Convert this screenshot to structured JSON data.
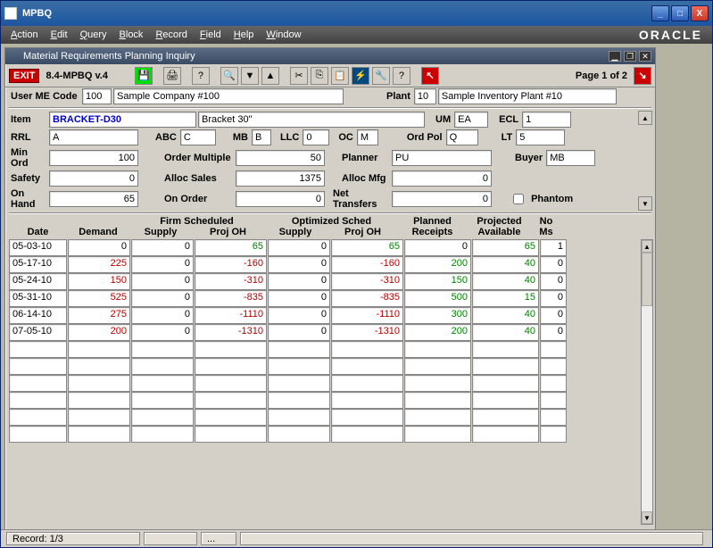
{
  "window_title": "MPBQ",
  "menu": [
    "Action",
    "Edit",
    "Query",
    "Block",
    "Record",
    "Field",
    "Help",
    "Window"
  ],
  "brand": "ORACLE",
  "sub_title": "Material Requirements Planning Inquiry",
  "exit_label": "EXIT",
  "version": "8.4-MPBQ v.4",
  "page_info": "Page 1 of 2",
  "header": {
    "user_me_label": "User ME Code",
    "user_me": "100",
    "company": "Sample Company #100",
    "plant_label": "Plant",
    "plant": "10",
    "plant_name": "Sample Inventory Plant #10"
  },
  "item": {
    "item_label": "Item",
    "item": "BRACKET-D30",
    "desc": "Bracket 30\"",
    "um_label": "UM",
    "um": "EA",
    "ecl_label": "ECL",
    "ecl": "1",
    "rrl_label": "RRL",
    "rrl": "A",
    "abc_label": "ABC",
    "abc": "C",
    "mb_label": "MB",
    "mb": "B",
    "llc_label": "LLC",
    "llc": "0",
    "oc_label": "OC",
    "oc": "M",
    "ordpol_label": "Ord Pol",
    "ordpol": "Q",
    "lt_label": "LT",
    "lt": "5",
    "minord_label": "Min Ord",
    "minord": "100",
    "ordmult_label": "Order Multiple",
    "ordmult": "50",
    "planner_label": "Planner",
    "planner": "PU",
    "buyer_label": "Buyer",
    "buyer": "MB",
    "safety_label": "Safety",
    "safety": "0",
    "allocsales_label": "Alloc Sales",
    "allocsales": "1375",
    "allocmfg_label": "Alloc Mfg",
    "allocmfg": "0",
    "onhand_label": "On Hand",
    "onhand": "65",
    "onorder_label": "On Order",
    "onorder": "0",
    "nettrans_label": "Net Transfers",
    "nettrans": "0",
    "phantom_label": "Phantom"
  },
  "grid": {
    "group1": "Firm Scheduled",
    "group2": "Optimized Sched",
    "cols": [
      "Date",
      "Demand",
      "Supply",
      "Proj OH",
      "Supply",
      "Proj OH",
      "Receipts",
      "Available",
      "Ms"
    ],
    "planned_label": "Planned",
    "projected_label": "Projected",
    "no_label": "No"
  },
  "rows": [
    {
      "date": "05-03-10",
      "demand": "0",
      "fs_supply": "0",
      "fs_proj": "65",
      "os_supply": "0",
      "os_proj": "65",
      "planned": "0",
      "projected": "65",
      "noms": "1"
    },
    {
      "date": "05-17-10",
      "demand": "225",
      "fs_supply": "0",
      "fs_proj": "-160",
      "os_supply": "0",
      "os_proj": "-160",
      "planned": "200",
      "projected": "40",
      "noms": "0"
    },
    {
      "date": "05-24-10",
      "demand": "150",
      "fs_supply": "0",
      "fs_proj": "-310",
      "os_supply": "0",
      "os_proj": "-310",
      "planned": "150",
      "projected": "40",
      "noms": "0"
    },
    {
      "date": "05-31-10",
      "demand": "525",
      "fs_supply": "0",
      "fs_proj": "-835",
      "os_supply": "0",
      "os_proj": "-835",
      "planned": "500",
      "projected": "15",
      "noms": "0"
    },
    {
      "date": "06-14-10",
      "demand": "275",
      "fs_supply": "0",
      "fs_proj": "-1110",
      "os_supply": "0",
      "os_proj": "-1110",
      "planned": "300",
      "projected": "40",
      "noms": "0"
    },
    {
      "date": "07-05-10",
      "demand": "200",
      "fs_supply": "0",
      "fs_proj": "-1310",
      "os_supply": "0",
      "os_proj": "-1310",
      "planned": "200",
      "projected": "40",
      "noms": "0"
    }
  ],
  "status": {
    "record": "Record: 1/3",
    "dots": "..."
  }
}
